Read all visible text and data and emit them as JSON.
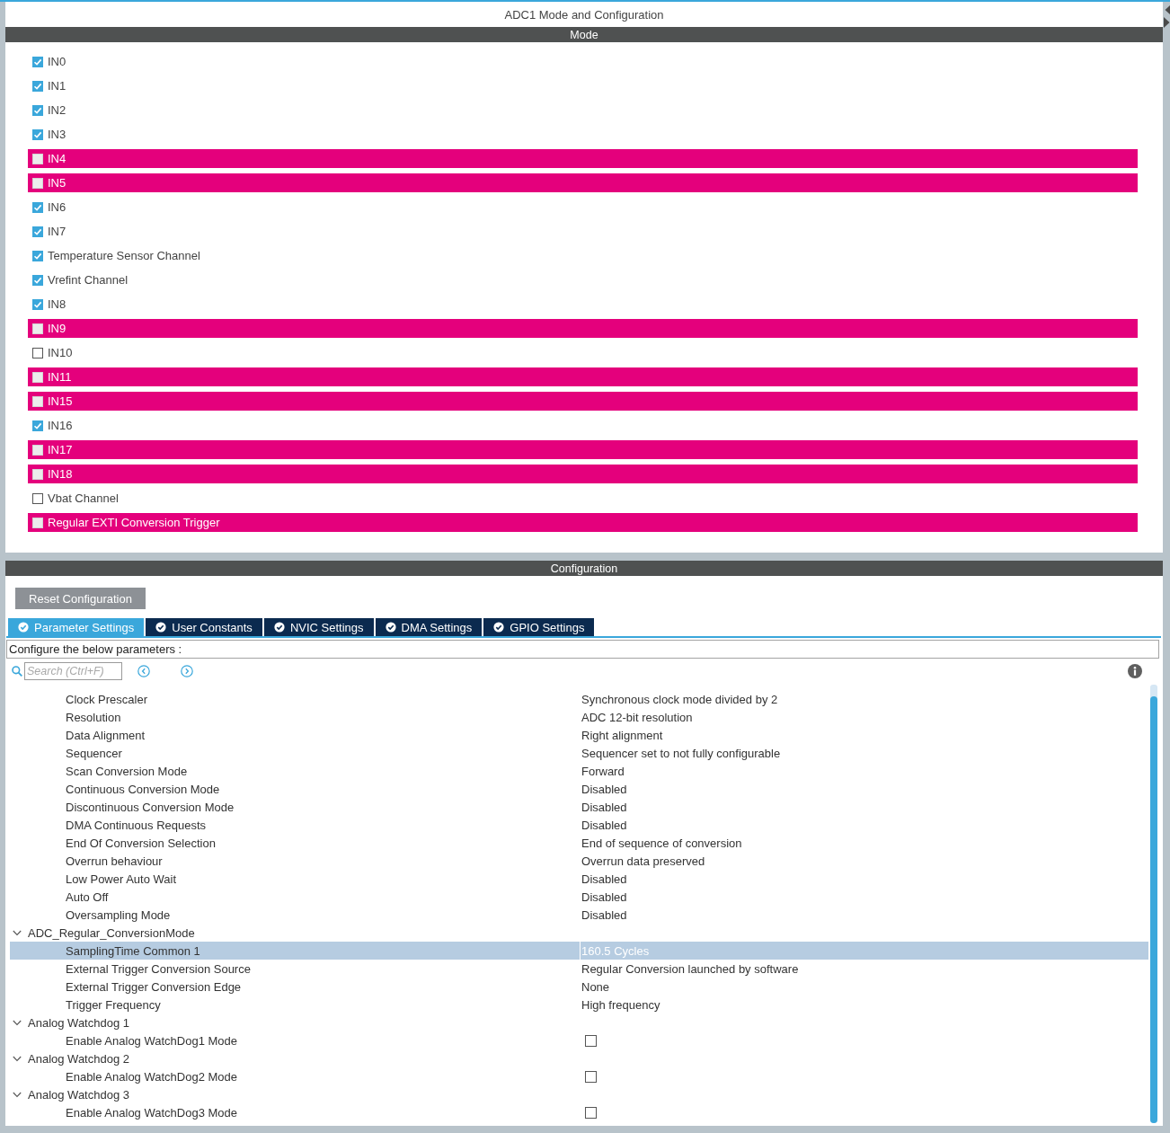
{
  "window": {
    "title": "ADC1 Mode and Configuration"
  },
  "mode": {
    "header": "Mode",
    "channels": [
      {
        "label": "IN0",
        "checked": true,
        "conflict": false
      },
      {
        "label": "IN1",
        "checked": true,
        "conflict": false
      },
      {
        "label": "IN2",
        "checked": true,
        "conflict": false
      },
      {
        "label": "IN3",
        "checked": true,
        "conflict": false
      },
      {
        "label": "IN4",
        "checked": false,
        "conflict": true
      },
      {
        "label": "IN5",
        "checked": false,
        "conflict": true
      },
      {
        "label": "IN6",
        "checked": true,
        "conflict": false
      },
      {
        "label": "IN7",
        "checked": true,
        "conflict": false
      },
      {
        "label": "Temperature Sensor Channel",
        "checked": true,
        "conflict": false
      },
      {
        "label": "Vrefint Channel",
        "checked": true,
        "conflict": false
      },
      {
        "label": "IN8",
        "checked": true,
        "conflict": false
      },
      {
        "label": "IN9",
        "checked": false,
        "conflict": true
      },
      {
        "label": "IN10",
        "checked": false,
        "conflict": false
      },
      {
        "label": "IN11",
        "checked": false,
        "conflict": true
      },
      {
        "label": "IN15",
        "checked": false,
        "conflict": true
      },
      {
        "label": "IN16",
        "checked": true,
        "conflict": false
      },
      {
        "label": "IN17",
        "checked": false,
        "conflict": true
      },
      {
        "label": "IN18",
        "checked": false,
        "conflict": true
      },
      {
        "label": "Vbat Channel",
        "checked": false,
        "conflict": false
      },
      {
        "label": "Regular EXTI Conversion Trigger",
        "checked": false,
        "conflict": true
      }
    ]
  },
  "configuration": {
    "header": "Configuration",
    "reset_button": "Reset Configuration",
    "tabs": [
      {
        "label": "Parameter Settings",
        "selected": true
      },
      {
        "label": "User Constants",
        "selected": false
      },
      {
        "label": "NVIC Settings",
        "selected": false
      },
      {
        "label": "DMA Settings",
        "selected": false
      },
      {
        "label": "GPIO Settings",
        "selected": false
      }
    ],
    "description": "Configure the below parameters :",
    "search": {
      "placeholder": "Search (Ctrl+F)"
    },
    "tree": [
      {
        "children": [
          {
            "label": "Clock Prescaler",
            "kind": "text",
            "value": "Synchronous clock mode divided by 2",
            "selected": false
          },
          {
            "label": "Resolution",
            "kind": "text",
            "value": "ADC 12-bit resolution",
            "selected": false
          },
          {
            "label": "Data Alignment",
            "kind": "text",
            "value": "Right alignment",
            "selected": false
          },
          {
            "label": "Sequencer",
            "kind": "text",
            "value": "Sequencer set to not fully configurable",
            "selected": false
          },
          {
            "label": "Scan Conversion Mode",
            "kind": "text",
            "value": "Forward",
            "selected": false
          },
          {
            "label": "Continuous Conversion Mode",
            "kind": "text",
            "value": "Disabled",
            "selected": false
          },
          {
            "label": "Discontinuous Conversion Mode",
            "kind": "text",
            "value": "Disabled",
            "selected": false
          },
          {
            "label": "DMA Continuous Requests",
            "kind": "text",
            "value": "Disabled",
            "selected": false
          },
          {
            "label": "End Of Conversion Selection",
            "kind": "text",
            "value": "End of sequence of conversion",
            "selected": false
          },
          {
            "label": "Overrun behaviour",
            "kind": "text",
            "value": "Overrun data preserved",
            "selected": false
          },
          {
            "label": "Low Power Auto Wait",
            "kind": "text",
            "value": "Disabled",
            "selected": false
          },
          {
            "label": "Auto Off",
            "kind": "text",
            "value": "Disabled",
            "selected": false
          },
          {
            "label": "Oversampling Mode",
            "kind": "text",
            "value": "Disabled",
            "selected": false
          }
        ]
      },
      {
        "label": "ADC_Regular_ConversionMode",
        "expanded": true,
        "children": [
          {
            "label": "SamplingTime Common 1",
            "kind": "text",
            "value": "160.5 Cycles",
            "selected": true
          },
          {
            "label": "External Trigger Conversion Source",
            "kind": "text",
            "value": "Regular Conversion launched by software",
            "selected": false
          },
          {
            "label": "External Trigger Conversion Edge",
            "kind": "text",
            "value": "None",
            "selected": false
          },
          {
            "label": "Trigger Frequency",
            "kind": "text",
            "value": "High frequency",
            "selected": false
          }
        ]
      },
      {
        "label": "Analog Watchdog 1",
        "expanded": true,
        "children": [
          {
            "label": "Enable Analog WatchDog1 Mode",
            "kind": "checkbox",
            "checked": false,
            "selected": false
          }
        ]
      },
      {
        "label": "Analog Watchdog 2",
        "expanded": true,
        "children": [
          {
            "label": "Enable Analog WatchDog2 Mode",
            "kind": "checkbox",
            "checked": false,
            "selected": false
          }
        ]
      },
      {
        "label": "Analog Watchdog 3",
        "expanded": true,
        "children": [
          {
            "label": "Enable Analog WatchDog3 Mode",
            "kind": "checkbox",
            "checked": false,
            "selected": false
          }
        ]
      }
    ]
  }
}
